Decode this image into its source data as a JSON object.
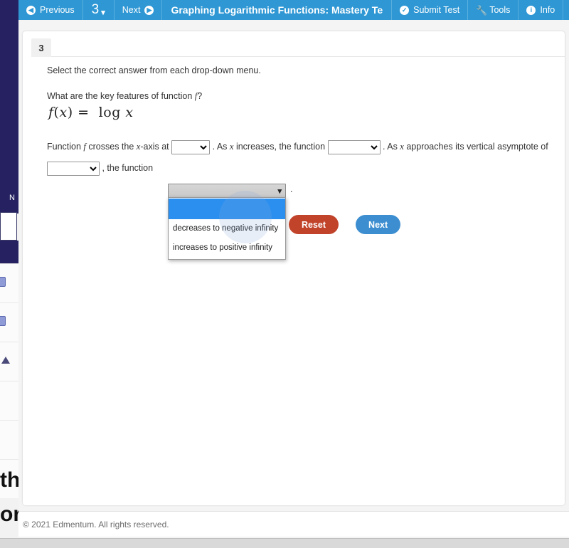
{
  "toolbar": {
    "previous_label": "Previous",
    "previous_icon": "arrow-left-circle-icon",
    "question_number": "3",
    "question_caret": "▾",
    "next_label": "Next",
    "next_icon": "arrow-right-circle-icon",
    "title": "Graphing Logarithmic Functions: Mastery Te",
    "submit_label": "Submit Test",
    "submit_icon": "check-circle-icon",
    "tools_label": "Tools",
    "tools_icon": "wrench-icon",
    "info_label": "Info",
    "info_icon": "info-circle-icon",
    "accent_color": "#2e97d4"
  },
  "question": {
    "tab_number": "3",
    "instruction": "Select the correct answer from each drop-down menu.",
    "prompt_prefix": "What are the key features of function ",
    "prompt_var": "f",
    "prompt_suffix": "?",
    "formula": {
      "fn": "f",
      "open": "(",
      "arg": "x",
      "close": ")",
      "equals": "=",
      "log": "log",
      "logarg": "x"
    },
    "sentence": {
      "part1": "Function ",
      "var1": "f",
      "part2": " crosses the ",
      "var2": "x",
      "part3": "-axis at ",
      "part4": " . As ",
      "var3": "x",
      "part5": " increases, the function ",
      "part6": " . As ",
      "var4": "x",
      "part7": " approaches its vertical asymptote of ",
      "part8": " , the function ",
      "part9": " ."
    },
    "dropdowns": {
      "xaxis": {
        "value": "",
        "placeholder": ""
      },
      "increases": {
        "value": "",
        "placeholder": ""
      },
      "asymptote": {
        "value": "",
        "placeholder": ""
      },
      "behavior": {
        "value": "",
        "state": "open",
        "options": [
          "",
          "decreases to negative infinity",
          "increases to positive infinity"
        ],
        "selected_index": 0,
        "highlight_color": "#2a8fef"
      }
    },
    "reset_label": "Reset",
    "next_label": "Next",
    "reset_color": "#c0432a",
    "next_color": "#3c8ed0"
  },
  "footer": {
    "copyright": "© 2021 Edmentum. All rights reserved."
  },
  "background_window": {
    "navy_color": "#262262",
    "nav_letter": "N",
    "partial_text_1": "th",
    "partial_text_2": "or"
  }
}
